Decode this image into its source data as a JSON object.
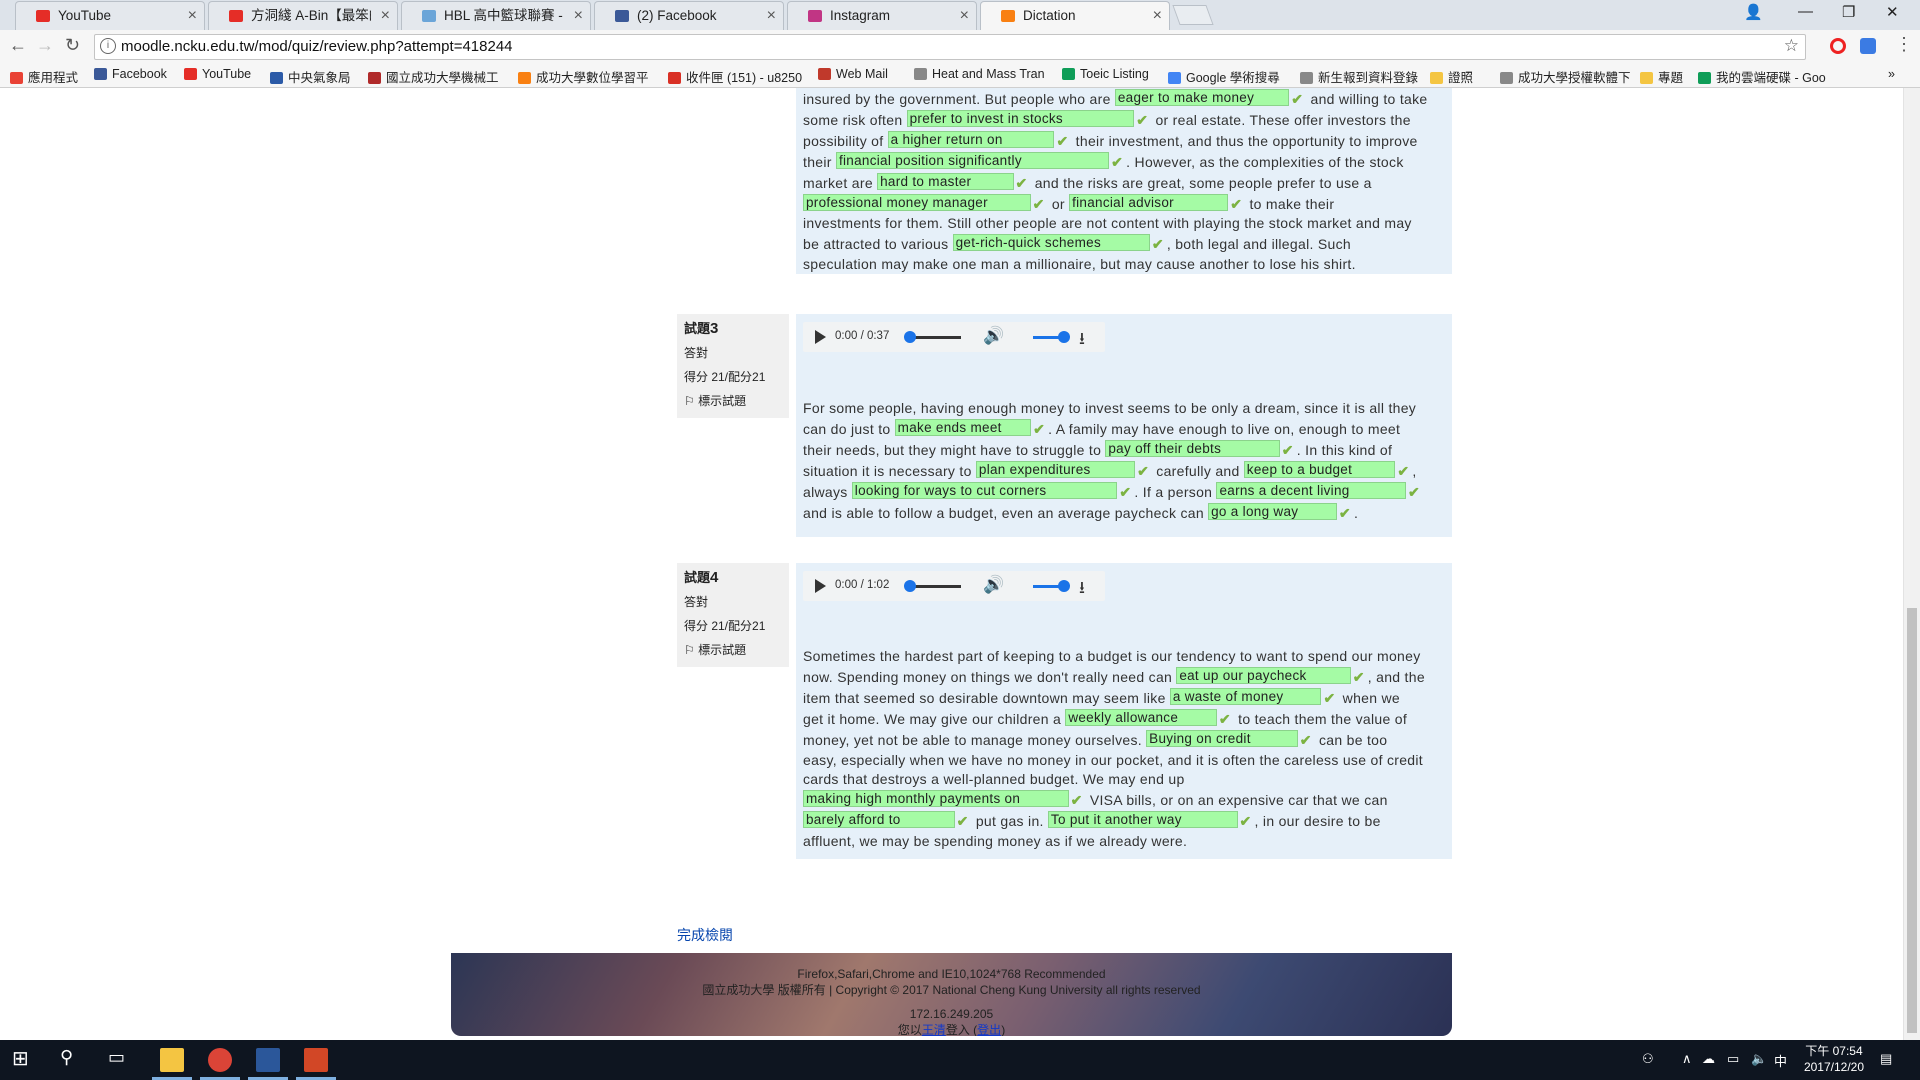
{
  "browser": {
    "tabs": [
      {
        "title": "YouTube",
        "icon": "youtube-icon",
        "color": "#e52d27",
        "active": false
      },
      {
        "title": "方洞綫 A-Bin【最笨的人",
        "icon": "youtube-icon",
        "color": "#e52d27",
        "active": false
      },
      {
        "title": "HBL 高中籃球聯賽 - ",
        "icon": "globe-icon",
        "color": "#6ba5d8",
        "active": false
      },
      {
        "title": "(2) Facebook",
        "icon": "facebook-icon",
        "color": "#3b5998",
        "active": false
      },
      {
        "title": "Instagram",
        "icon": "instagram-icon",
        "color": "#c13584",
        "active": false
      },
      {
        "title": "Dictation",
        "icon": "moodle-icon",
        "color": "#f98012",
        "active": true
      }
    ],
    "url": "moodle.ncku.edu.tw/mod/quiz/review.php?attempt=418244",
    "bookmarks": [
      {
        "label": "應用程式",
        "icon": "apps-icon",
        "color": "#e94235"
      },
      {
        "label": "Facebook",
        "icon": "facebook-icon",
        "color": "#3b5998"
      },
      {
        "label": "YouTube",
        "icon": "youtube-icon",
        "color": "#e52d27"
      },
      {
        "label": "中央氣象局",
        "icon": "weather-icon",
        "color": "#2b5aa7"
      },
      {
        "label": "國立成功大學機械工",
        "icon": "ncku-icon",
        "color": "#b02a2a"
      },
      {
        "label": "成功大學數位學習平",
        "icon": "moodle-icon",
        "color": "#f98012"
      },
      {
        "label": "收件匣 (151) - u8250",
        "icon": "gmail-icon",
        "color": "#d93025"
      },
      {
        "label": "Web Mail",
        "icon": "webmail-icon",
        "color": "#c0392b"
      },
      {
        "label": "Heat and Mass Tran",
        "icon": "page-icon",
        "color": "#888888"
      },
      {
        "label": "Toeic Listing",
        "icon": "drive-icon",
        "color": "#0f9d58"
      },
      {
        "label": "Google 學術搜尋",
        "icon": "scholar-icon",
        "color": "#4285f4"
      },
      {
        "label": "新生報到資料登錄",
        "icon": "page-icon",
        "color": "#888888"
      },
      {
        "label": "證照",
        "icon": "folder-icon",
        "color": "#f4c542"
      },
      {
        "label": "成功大學授權軟體下",
        "icon": "page-icon",
        "color": "#888888"
      },
      {
        "label": "專題",
        "icon": "folder-icon",
        "color": "#f4c542"
      },
      {
        "label": "我的雲端硬碟 - Goo",
        "icon": "drive-icon",
        "color": "#0f9d58"
      }
    ]
  },
  "q2": {
    "lines": [
      [
        {
          "t": "insured by the government. But people who are "
        },
        {
          "a": "eager to make money"
        },
        {
          "t": " and willing to take"
        }
      ],
      [
        {
          "t": "some risk often "
        },
        {
          "a": "prefer to invest in stocks"
        },
        {
          "t": " or real estate. These offer investors the"
        }
      ],
      [
        {
          "t": "possibility of "
        },
        {
          "a": "a higher return on"
        },
        {
          "t": " their investment, and thus the opportunity to improve"
        }
      ],
      [
        {
          "t": "their "
        },
        {
          "a": "financial position significantly"
        },
        {
          "t": ". However, as the complexities of the stock"
        }
      ],
      [
        {
          "t": "market are "
        },
        {
          "a": "hard to master"
        },
        {
          "t": " and the risks are great, some people prefer to use a"
        }
      ],
      [
        {
          "a": "professional money manager"
        },
        {
          "t": " or "
        },
        {
          "a": "financial advisor"
        },
        {
          "t": " to make their"
        }
      ],
      [
        {
          "t": "investments for them. Still other people are not content with playing the stock market and may"
        }
      ],
      [
        {
          "t": "be attracted to various "
        },
        {
          "a": "get-rich-quick schemes"
        },
        {
          "t": ", both legal and illegal. Such"
        }
      ],
      [
        {
          "t": "speculation may make one man a millionaire, but may cause another to lose his shirt."
        }
      ]
    ]
  },
  "q3": {
    "num_prefix": "試題",
    "num": "3",
    "status": "答對",
    "score": "得分 21/配分21",
    "flag": "標示試題",
    "time": "0:00 / 0:37",
    "lines": [
      [
        {
          "t": "For some people, having enough money to invest seems to be only a dream, since it is all they"
        }
      ],
      [
        {
          "t": "can do just to "
        },
        {
          "a": "make ends meet"
        },
        {
          "t": ". A family may have enough to live on, enough to meet"
        }
      ],
      [
        {
          "t": "their needs, but they might have to struggle to "
        },
        {
          "a": "pay off their debts"
        },
        {
          "t": ". In this kind of"
        }
      ],
      [
        {
          "t": "situation it is necessary to "
        },
        {
          "a": "plan expenditures"
        },
        {
          "t": " carefully and "
        },
        {
          "a": "keep to a budget"
        },
        {
          "t": ","
        }
      ],
      [
        {
          "t": "always "
        },
        {
          "a": "looking for ways to cut corners"
        },
        {
          "t": ". If a person "
        },
        {
          "a": "earns a decent living"
        }
      ],
      [
        {
          "t": " and is able to follow a budget, even an average paycheck can "
        },
        {
          "a": "go a long way"
        },
        {
          "t": "."
        }
      ]
    ]
  },
  "q4": {
    "num_prefix": "試題",
    "num": "4",
    "status": "答對",
    "score": "得分 21/配分21",
    "flag": "標示試題",
    "time": "0:00 / 1:02",
    "lines": [
      [
        {
          "t": "Sometimes the hardest part of keeping to a budget is our tendency to want to spend our money"
        }
      ],
      [
        {
          "t": "now. Spending money on things we don't really need can "
        },
        {
          "a": "eat up our paycheck"
        },
        {
          "t": ", and the"
        }
      ],
      [
        {
          "t": "item that seemed so desirable downtown may seem like "
        },
        {
          "a": "a waste of money"
        },
        {
          "t": " when we"
        }
      ],
      [
        {
          "t": "get it home. We may give our children a "
        },
        {
          "a": "weekly allowance"
        },
        {
          "t": " to teach them the value of"
        }
      ],
      [
        {
          "t": "money, yet not be able to manage money ourselves. "
        },
        {
          "a": "Buying on credit"
        },
        {
          "t": " can be too"
        }
      ],
      [
        {
          "t": "easy, especially when we have no money in our pocket, and it is often the careless use of credit"
        }
      ],
      [
        {
          "t": "cards that destroys a well-planned budget. We may end up"
        }
      ],
      [
        {
          "a": "making high monthly payments on"
        },
        {
          "t": " VISA bills, or on an expensive car that we can"
        }
      ],
      [
        {
          "a": "barely afford to"
        },
        {
          "t": " put gas in. "
        },
        {
          "a": "To put it another way"
        },
        {
          "t": ", in our desire to be"
        }
      ],
      [
        {
          "t": "affluent, we may be spending money as if we already were."
        }
      ]
    ]
  },
  "finish_link": "完成檢閱",
  "footer": {
    "line1": "Firefox,Safari,Chrome and IE10,1024*768 Recommended",
    "line2": "國立成功大學 版權所有 | Copyright © 2017 National Cheng Kung University all rights reserved",
    "ip": "172.16.249.205",
    "login_prefix": "您以",
    "login_user": "王清",
    "login_mid": "登入 (",
    "logout": "登出",
    "login_suffix": ")"
  },
  "taskbar": {
    "time": "下午 07:54",
    "date": "2017/12/20",
    "ime": "中",
    "apps": [
      {
        "name": "file-explorer-icon",
        "color": "#f4c542"
      },
      {
        "name": "chrome-icon",
        "color": "#db4437"
      },
      {
        "name": "word-icon",
        "color": "#2b579a"
      },
      {
        "name": "powerpoint-icon",
        "color": "#d24726"
      }
    ]
  }
}
